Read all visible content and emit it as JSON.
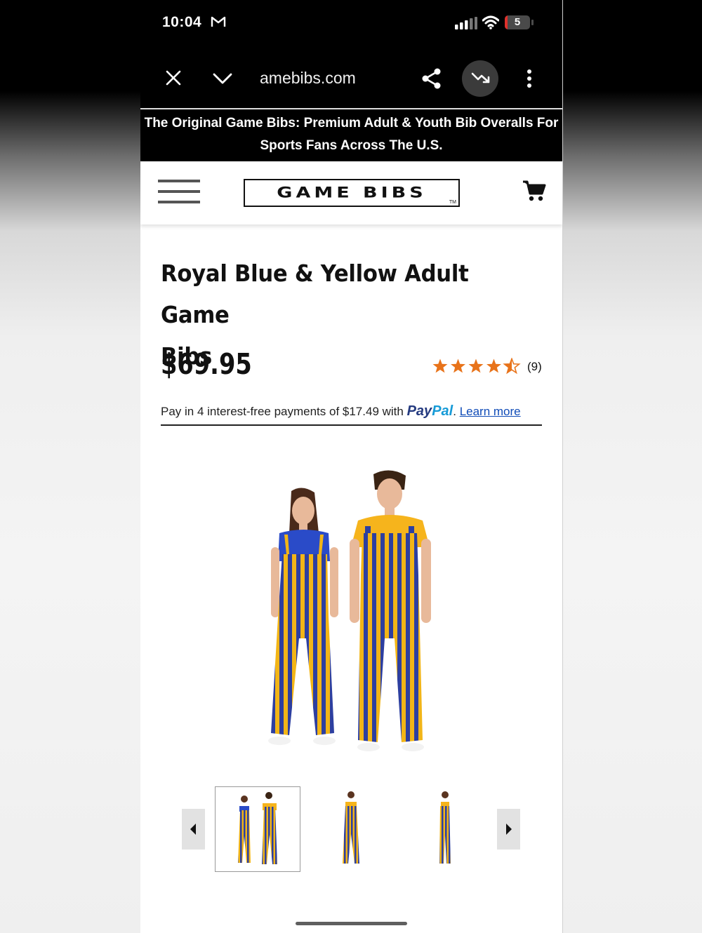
{
  "status_bar": {
    "time": "10:04",
    "battery": "5",
    "battery_level_percent": 5,
    "icons": [
      "gmail-icon",
      "cellular-signal-icon",
      "wifi-icon",
      "battery-icon"
    ]
  },
  "browser": {
    "url": "amebibs.com",
    "icons": [
      "close-icon",
      "chevron-down-icon",
      "share-icon",
      "trending-down-icon",
      "more-vertical-icon"
    ]
  },
  "announcement": {
    "line1": "The Original Game Bibs: Premium Adult & Youth Bib Overalls For",
    "line2": "Sports Fans Across The U.S."
  },
  "site_header": {
    "logo_text": "GAME BIBS",
    "logo_tm": "TM",
    "icons": [
      "hamburger-menu-icon",
      "shopping-cart-icon"
    ]
  },
  "product": {
    "title_line1": "Royal Blue & Yellow Adult Game",
    "title_line2": "Bibs",
    "price": "$69.95",
    "rating": 4.5,
    "rating_max": 5,
    "review_count": "(9)",
    "paypal": {
      "text": "Pay in 4 interest-free payments of $17.49 with",
      "brand_part1": "Pay",
      "brand_part2": "Pal",
      "period": ".",
      "learn_more": "Learn more"
    }
  },
  "colors": {
    "bib_blue": "#2d3fa0",
    "bib_yellow": "#f2b517",
    "star_orange": "#e8731a",
    "link_blue": "#0f4bb7",
    "paypal_dark": "#253b80",
    "paypal_light": "#179bd7"
  },
  "gallery": {
    "thumbnails": [
      "two-models-front",
      "woman-front",
      "woman-side"
    ],
    "active_index": 0
  }
}
